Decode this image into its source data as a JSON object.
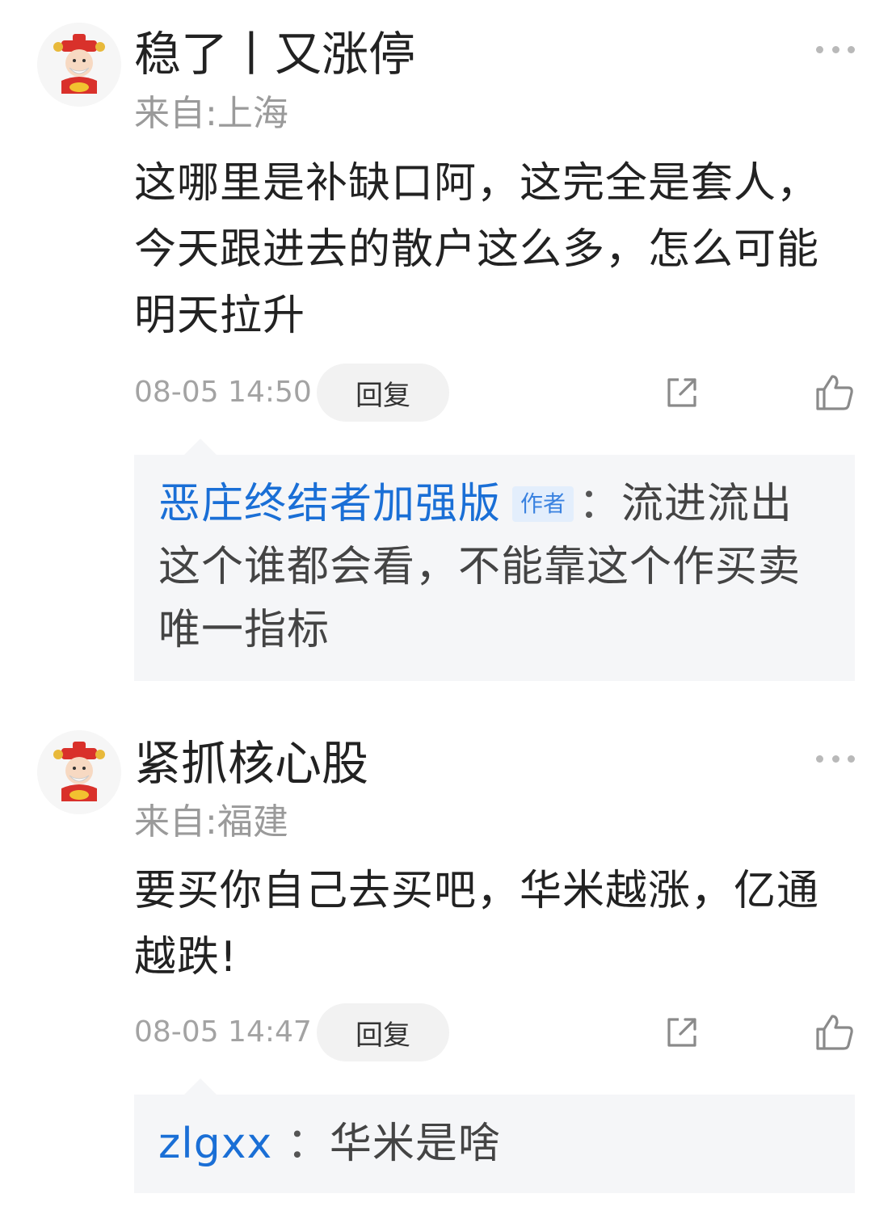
{
  "comments": [
    {
      "username": "稳了丨又涨停",
      "location": "来自:上海",
      "text": "这哪里是补缺口阿，这完全是套人，今天跟进去的散户这么多，怎么可能明天拉升",
      "time": "08-05 14:50",
      "reply_label": "回复",
      "reply": {
        "user": "恶庄终结者加强版",
        "tag": "作者",
        "separator": "：",
        "text": "流进流出这个谁都会看，不能靠这个作买卖唯一指标"
      }
    },
    {
      "username": "紧抓核心股",
      "location": "来自:福建",
      "text": "要买你自己去买吧，华米越涨，亿通越跌!",
      "time": "08-05 14:47",
      "reply_label": "回复",
      "reply": {
        "user": "zlgxx",
        "separator": " ：",
        "text": "华米是啥"
      }
    }
  ],
  "icons": {
    "more": "more-dots-icon",
    "share": "share-icon",
    "like": "thumbs-up-icon",
    "avatar": "fortune-god-avatar"
  },
  "colors": {
    "link_blue": "#1a6fd6",
    "meta_gray": "#a3a3a3",
    "reply_bg": "#f5f6f8"
  }
}
